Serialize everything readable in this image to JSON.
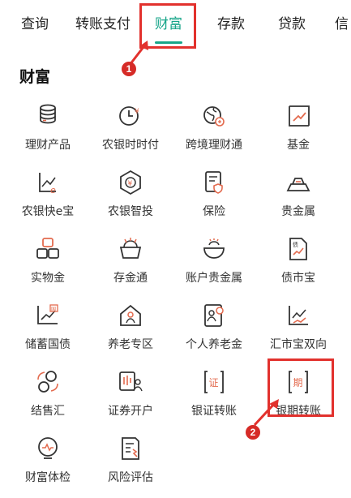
{
  "tabs": [
    {
      "label": "查询"
    },
    {
      "label": "转账支付"
    },
    {
      "label": "财富",
      "active": true
    },
    {
      "label": "存款"
    },
    {
      "label": "贷款"
    },
    {
      "label": "信"
    }
  ],
  "section": {
    "title": "财富"
  },
  "items": [
    {
      "label": "理财产品",
      "icon": "coin-stack-icon"
    },
    {
      "label": "农银时时付",
      "icon": "yen-clock-icon"
    },
    {
      "label": "跨境理财通",
      "icon": "globe-icon"
    },
    {
      "label": "基金",
      "icon": "trend-chart-icon"
    },
    {
      "label": "农银快e宝",
      "icon": "chart-e-icon"
    },
    {
      "label": "农银智投",
      "icon": "hexagon-coin-icon"
    },
    {
      "label": "保险",
      "icon": "shield-document-icon"
    },
    {
      "label": "贵金属",
      "icon": "gold-bar-icon"
    },
    {
      "label": "实物金",
      "icon": "gold-blocks-icon"
    },
    {
      "label": "存金通",
      "icon": "basket-icon"
    },
    {
      "label": "账户贵金属",
      "icon": "bowl-icon"
    },
    {
      "label": "债市宝",
      "icon": "bond-document-icon"
    },
    {
      "label": "储蓄国债",
      "icon": "national-bond-icon"
    },
    {
      "label": "养老专区",
      "icon": "house-person-icon"
    },
    {
      "label": "个人养老金",
      "icon": "pension-card-icon"
    },
    {
      "label": "汇市宝双向",
      "icon": "fx-trend-icon"
    },
    {
      "label": "结售汇",
      "icon": "exchange-icon"
    },
    {
      "label": "证券开户",
      "icon": "stock-person-icon"
    },
    {
      "label": "银证转账",
      "icon": "securities-icon",
      "badge": "证"
    },
    {
      "label": "银期转账",
      "icon": "futures-icon",
      "badge": "期"
    },
    {
      "label": "财富体检",
      "icon": "checkup-icon"
    },
    {
      "label": "风险评估",
      "icon": "risk-assessment-icon"
    }
  ],
  "annotations": [
    {
      "number": "1"
    },
    {
      "number": "2"
    }
  ],
  "colors": {
    "accent": "#17a589",
    "annotation": "#e2312d",
    "icon_stroke": "#333333"
  }
}
